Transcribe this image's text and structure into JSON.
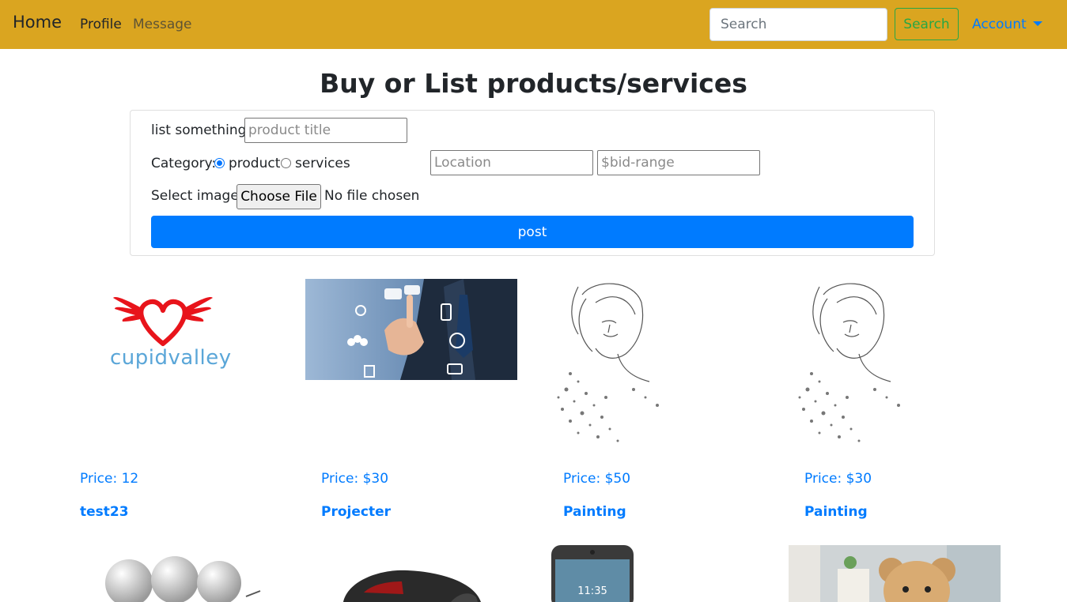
{
  "navbar": {
    "brand": "Home",
    "links": [
      "Profile",
      "Message"
    ],
    "search_placeholder": "Search",
    "search_button": "Search",
    "account": "Account",
    "background_color": "#daa520"
  },
  "page_title": "Buy or List products/services",
  "form": {
    "list_label": "list something:",
    "title_placeholder": "product title",
    "category_label": "Category:",
    "category_options": [
      "product",
      "services"
    ],
    "category_selected": "product",
    "location_placeholder": "Location",
    "bid_placeholder": "$bid-range",
    "image_label": "Select image:",
    "file_button": "Choose File",
    "file_status": "No file chosen",
    "post_button": "post"
  },
  "products": [
    {
      "price": "Price: 12",
      "title": "test23",
      "image": "cupidvalley-logo",
      "logo_text": "cupidvalley"
    },
    {
      "price": "Price: $30",
      "title": "Projecter",
      "image": "business-touch-screen-photo"
    },
    {
      "price": "Price: $50",
      "title": "Painting",
      "image": "woman-sketch-drawing"
    },
    {
      "price": "Price: $30",
      "title": "Painting",
      "image": "woman-sketch-drawing"
    }
  ],
  "second_row_images": [
    "white-figures-photo",
    "car-mouse-photo",
    "smartphone-photo",
    "teddy-bear-photo"
  ],
  "colors": {
    "link": "#007bff",
    "primary": "#007bff",
    "success": "#28a745"
  }
}
